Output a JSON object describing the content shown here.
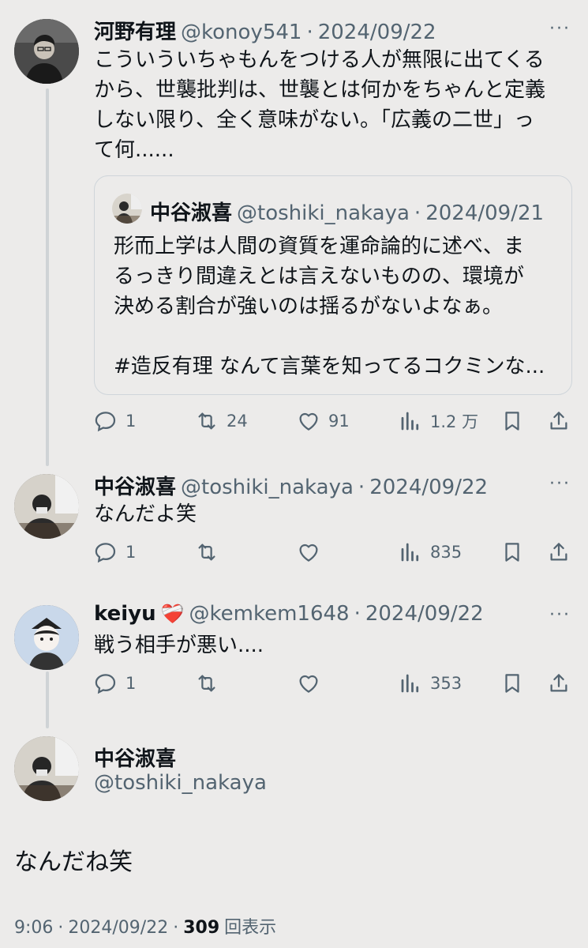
{
  "tweet1": {
    "name": "河野有理",
    "handle": "@konoy541",
    "separator": "·",
    "date": "2024/09/22",
    "more": "···",
    "lines": [
      "こういういちゃもんをつける人が無限に出てくる",
      "から、世襲批判は、世襲とは何かをちゃんと定義",
      "しない限り、全く意味がない。「広義の二世」っ",
      "て何......"
    ],
    "quote": {
      "name": "中谷淑喜",
      "handle": "@toshiki_nakaya",
      "separator": "·",
      "date": "2024/09/21",
      "lines": [
        "形而上学は人間の資質を運命論的に述べ、ま",
        "るっきり間違えとは言えないものの、環境が",
        "決める割合が強いのは揺るがないよなぁ。",
        "",
        "#造反有理 なんて言葉を知ってるコクミンな..."
      ]
    },
    "stats": {
      "replies": "1",
      "retweets": "24",
      "likes": "91",
      "views": "1.2 万"
    }
  },
  "tweet2": {
    "name": "中谷淑喜",
    "handle": "@toshiki_nakaya",
    "separator": "·",
    "date": "2024/09/22",
    "more": "···",
    "text": "なんだよ笑",
    "stats": {
      "replies": "1",
      "retweets": "",
      "likes": "",
      "views": "835"
    }
  },
  "tweet3": {
    "name": "keiyu",
    "badge": "❤️‍🩹",
    "handle": "@kemkem1648",
    "separator": "·",
    "date": "2024/09/22",
    "more": "···",
    "text": "戦う相手が悪い....",
    "stats": {
      "replies": "1",
      "retweets": "",
      "likes": "",
      "views": "353"
    }
  },
  "main": {
    "name": "中谷淑喜",
    "handle": "@toshiki_nakaya",
    "text": "なんだね笑",
    "time": "9:06",
    "separator": "·",
    "date": "2024/09/22",
    "separator2": "·",
    "views_count": "309",
    "views_label": "回表示"
  },
  "icons": [
    "reply-icon",
    "retweet-icon",
    "like-icon",
    "views-icon",
    "bookmark-icon",
    "share-icon",
    "more-icon"
  ]
}
